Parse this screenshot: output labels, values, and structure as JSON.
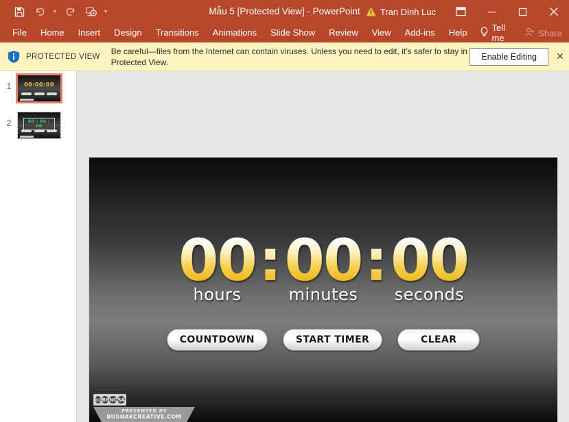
{
  "titlebar": {
    "document_title": "Mẫu 5 [Protected View]  -  PowerPoint",
    "account_name": "Tran Dinh Luc",
    "quick_access": [
      {
        "name": "save-button",
        "label": "Save"
      },
      {
        "name": "undo-button",
        "label": "Undo"
      },
      {
        "name": "redo-button",
        "label": "Redo"
      },
      {
        "name": "start-from-beginning-button",
        "label": "Start From Beginning"
      },
      {
        "name": "customize-quick-access-toolbar-button",
        "label": "Customize Quick Access Toolbar"
      }
    ],
    "window_controls": [
      {
        "name": "ribbon-display-options-button",
        "label": "Ribbon Display Options"
      },
      {
        "name": "minimize-button",
        "label": "Minimize"
      },
      {
        "name": "maximize-button",
        "label": "Maximize"
      },
      {
        "name": "close-button",
        "label": "Close"
      }
    ]
  },
  "ribbon": {
    "tabs": [
      {
        "label": "File"
      },
      {
        "label": "Home"
      },
      {
        "label": "Insert"
      },
      {
        "label": "Design"
      },
      {
        "label": "Transitions"
      },
      {
        "label": "Animations"
      },
      {
        "label": "Slide Show"
      },
      {
        "label": "Review"
      },
      {
        "label": "View"
      },
      {
        "label": "Add-ins"
      },
      {
        "label": "Help"
      }
    ],
    "tell_me": "Tell me",
    "share": "Share"
  },
  "protected_view": {
    "label": "PROTECTED VIEW",
    "message": "Be careful—files from the Internet can contain viruses. Unless you need to edit, it's safer to stay in Protected View.",
    "enable_editing": "Enable Editing",
    "close": "✕"
  },
  "thumbnails": [
    {
      "number": "1",
      "selected": true,
      "digits": "00:00:00"
    },
    {
      "number": "2",
      "selected": false,
      "digits": "00 : 00 : 00"
    }
  ],
  "slide": {
    "timer": {
      "hours": {
        "value": "00",
        "label": "hours"
      },
      "minutes": {
        "value": "00",
        "label": "minutes"
      },
      "seconds": {
        "value": "00",
        "label": "seconds"
      },
      "separator": ":"
    },
    "buttons": [
      {
        "label": "COUNTDOWN"
      },
      {
        "label": "START TIMER"
      },
      {
        "label": "CLEAR"
      }
    ],
    "footer": {
      "cc_marks": [
        "cc",
        "BY",
        "NC",
        "SA"
      ],
      "presented_by": "PRESENTED BY",
      "site": "BUSNAKCREATIVE.COM"
    }
  },
  "colors": {
    "ribbon_orange": "#b7472a",
    "protected_view_yellow": "#fdf4bf",
    "timer_gold": "#f0bc25",
    "thumbnail_selected": "#e8836b"
  }
}
